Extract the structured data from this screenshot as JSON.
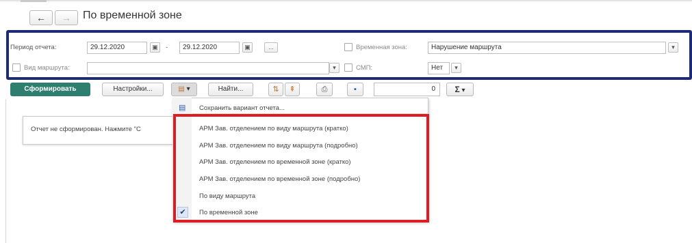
{
  "header": {
    "back_glyph": "←",
    "forward_glyph": "→",
    "title": "По временной зоне"
  },
  "filters": {
    "period_label": "Период отчета:",
    "date_from": "29.12.2020",
    "date_to": "29.12.2020",
    "date_separator": "-",
    "calendar_glyph": "▣",
    "ellipsis": "...",
    "route_type_label": "Вид маршрута:",
    "route_type_value": "",
    "dropdown_glyph": "▾",
    "time_zone_label": "Временная зона:",
    "time_zone_value": "Нарушение маршрута",
    "smp_label": "СМП:",
    "smp_value": "Нет"
  },
  "toolbar": {
    "generate_label": "Сформировать",
    "settings_label": "Настройки...",
    "find_label": "Найти...",
    "sum_value": "0",
    "sigma_glyph": "Σ",
    "variant_icon_glyph": "▤",
    "print_glyph": "⎙",
    "save_glyph": "▪",
    "expand_glyph": "⇅",
    "collapse_glyph": "⇞",
    "dropdown_glyph": "▾"
  },
  "message": {
    "text": "Отчет не сформирован. Нажмите \"С"
  },
  "menu": {
    "save_item_label": "Сохранить вариант отчета...",
    "save_icon_glyph": "▤",
    "check_glyph": "✔",
    "items": [
      {
        "label": "АРМ Зав. отделением по виду маршрута (кратко)",
        "checked": false
      },
      {
        "label": "АРМ Зав. отделением по виду маршрута (подробно)",
        "checked": false
      },
      {
        "label": "АРМ Зав. отделением по временной зоне (кратко)",
        "checked": false
      },
      {
        "label": "АРМ Зав. отделением по временной зоне (подробно)",
        "checked": false
      },
      {
        "label": "По виду маршрута",
        "checked": false
      },
      {
        "label": "По временной зоне",
        "checked": true
      }
    ]
  },
  "colors": {
    "panel_border": "#1c2a78",
    "highlight_border": "#e11b22",
    "generate_button": "#2f7f71"
  }
}
